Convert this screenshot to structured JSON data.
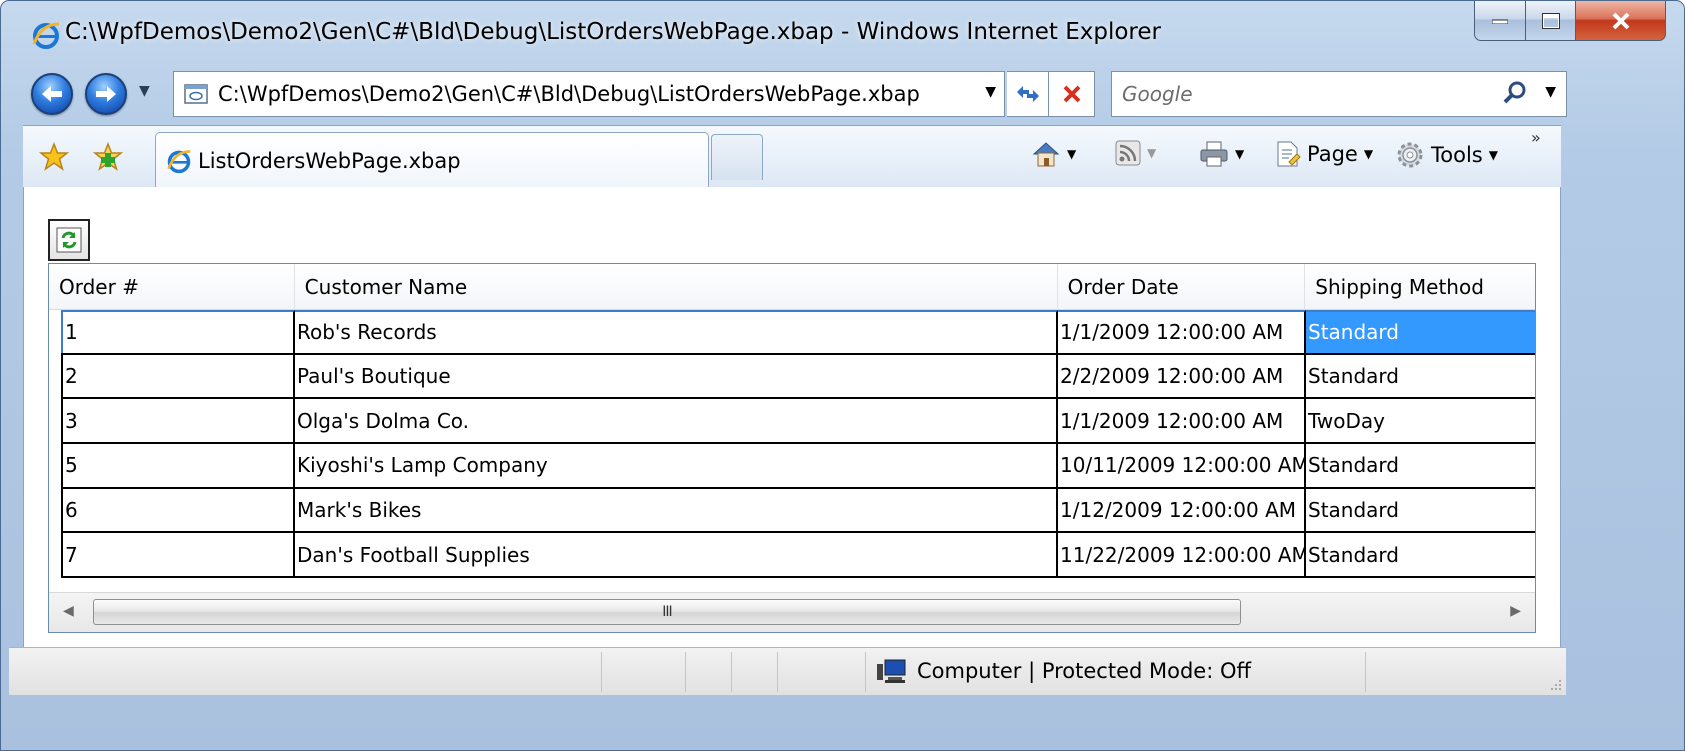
{
  "window": {
    "title": "C:\\WpfDemos\\Demo2\\Gen\\C#\\Bld\\Debug\\ListOrdersWebPage.xbap - Windows Internet Explorer"
  },
  "navbar": {
    "address": "C:\\WpfDemos\\Demo2\\Gen\\C#\\Bld\\Debug\\ListOrdersWebPage.xbap",
    "search_placeholder": "Google"
  },
  "tabbar": {
    "tab_label": "ListOrdersWebPage.xbap",
    "page_menu": "Page",
    "tools_menu": "Tools",
    "more": "»"
  },
  "grid": {
    "columns": [
      "Order #",
      "Customer Name",
      "Order Date",
      "Shipping Method"
    ],
    "rows": [
      [
        "1",
        "Rob's Records",
        "1/1/2009 12:00:00 AM",
        "Standard"
      ],
      [
        "2",
        "Paul's Boutique",
        "2/2/2009 12:00:00 AM",
        "Standard"
      ],
      [
        "3",
        "Olga's Dolma Co.",
        "1/1/2009 12:00:00 AM",
        "TwoDay"
      ],
      [
        "5",
        "Kiyoshi's Lamp Company",
        "10/11/2009 12:00:00 AM",
        "Standard"
      ],
      [
        "6",
        "Mark's Bikes",
        "1/12/2009 12:00:00 AM",
        "Standard"
      ],
      [
        "7",
        "Dan's Football Supplies",
        "11/22/2009 12:00:00 AM",
        "Standard"
      ]
    ],
    "scroll_grip": "III"
  },
  "statusbar": {
    "zone": "Computer | Protected Mode: Off"
  },
  "colors": {
    "selection": "#3399ff",
    "close_button": "#c2381c",
    "frame": "#b3cbe6"
  },
  "icons": [
    "ie-icon",
    "back-icon",
    "forward-icon",
    "refresh-icon",
    "stop-icon",
    "search-icon",
    "favorites-star-icon",
    "add-favorites-icon",
    "home-icon",
    "feeds-icon",
    "print-icon",
    "page-icon",
    "tools-gear-icon",
    "computer-zone-icon"
  ]
}
